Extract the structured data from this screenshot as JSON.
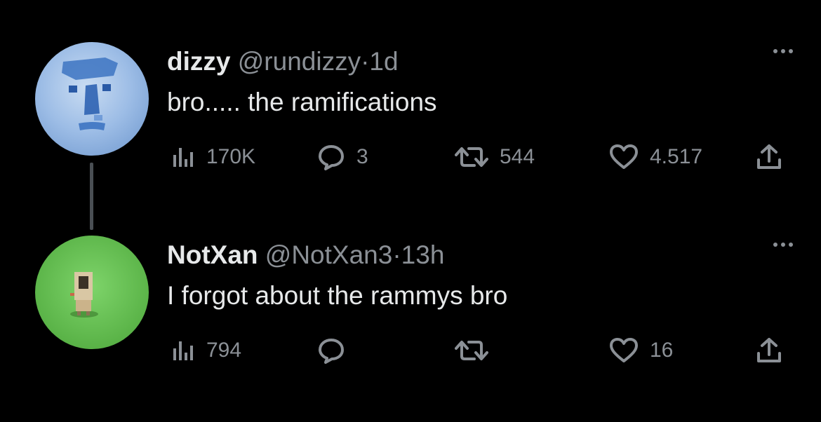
{
  "colors": {
    "background": "#000000",
    "primary_text": "#e7e9ea",
    "secondary_text": "#8b9096",
    "thread_line": "#4a4f54"
  },
  "tweets": [
    {
      "display_name": "dizzy",
      "handle": "@rundizzy",
      "separator": "·",
      "time": "1d",
      "text": "bro.....  the ramifications",
      "views": "170K",
      "replies": "3",
      "retweets": "544",
      "likes": "4.517",
      "avatar_icon": "blue-moai-face-avatar"
    },
    {
      "display_name": "NotXan",
      "handle": "@NotXan3",
      "separator": "·",
      "time": "13h",
      "text": "I forgot about the rammys bro",
      "views": "794",
      "replies": "",
      "retweets": "",
      "likes": "16",
      "avatar_icon": "green-grass-character-avatar"
    }
  ]
}
